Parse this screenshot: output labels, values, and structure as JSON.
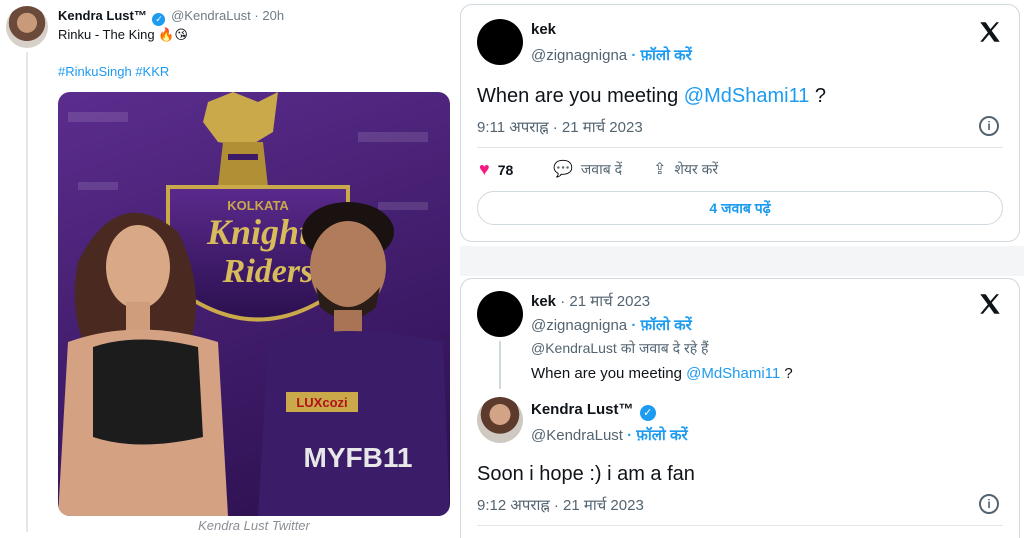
{
  "left_tweet": {
    "author_name": "Kendra Lust™",
    "author_handle": "@KendraLust",
    "time": "· 20h",
    "text": "Rinku - The King 🔥😘",
    "hashtags": "#RinkuSingh #KKR",
    "image_caption": "Kendra Lust Twitter",
    "image_logo_top": "KOLKATA",
    "image_logo_main_1": "Knight",
    "image_logo_main_2": "Riders",
    "jersey_sponsor_1": "LUXcozi",
    "jersey_sponsor_2": "MYFB11"
  },
  "top_card": {
    "author_name": "kek",
    "author_handle": "@zignagnigna",
    "follow_label": "· फ़ॉलो करें",
    "text_prefix": "When are you meeting",
    "mention": "@MdShami11",
    "text_suffix": "?",
    "timestamp": "9:11 अपराह्न · 21 मार्च 2023",
    "likes_count": "78",
    "reply_label": "जवाब दें",
    "share_label": "शेयर करें",
    "read_replies_label": "4 जवाब पढ़ें"
  },
  "bottom_card": {
    "author_name": "kek",
    "author_date": "· 21 मार्च 2023",
    "author_handle": "@zignagnigna",
    "follow_label": "· फ़ॉलो करें",
    "replying_to": "@KendraLust को जवाब दे रहे हैं",
    "quoted_prefix": "When are you meeting",
    "quoted_mention": "@MdShami11",
    "quoted_suffix": "?",
    "reply_author_name": "Kendra Lust™",
    "reply_author_handle": "@KendraLust",
    "reply_follow_label": "· फ़ॉलो करें",
    "reply_text": "Soon i hope :) i am a fan",
    "reply_timestamp": "9:12 अपराह्न · 21 मार्च 2023"
  },
  "colors": {
    "accent": "#1d9bf0",
    "like": "#f91880",
    "kkr_purple": "#3d1a66",
    "kkr_gold": "#c9a94a"
  },
  "icons": [
    "x-logo-icon",
    "info-icon",
    "heart-icon",
    "reply-bubble-icon",
    "share-icon",
    "verified-badge-icon"
  ]
}
